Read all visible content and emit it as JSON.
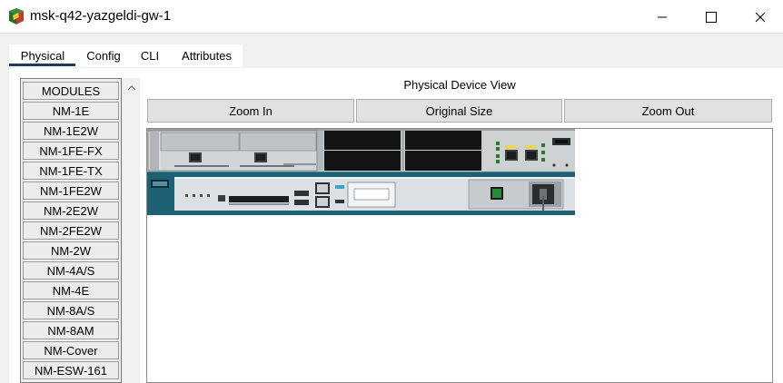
{
  "window": {
    "title": "msk-q42-yazgeldi-gw-1",
    "icon": "router-app-icon"
  },
  "tabs": [
    {
      "label": "Physical",
      "active": true
    },
    {
      "label": "Config",
      "active": false
    },
    {
      "label": "CLI",
      "active": false
    },
    {
      "label": "Attributes",
      "active": false
    }
  ],
  "modules": {
    "header": "MODULES",
    "items": [
      "NM-1E",
      "NM-1E2W",
      "NM-1FE-FX",
      "NM-1FE-TX",
      "NM-1FE2W",
      "NM-2E2W",
      "NM-2FE2W",
      "NM-2W",
      "NM-4A/S",
      "NM-4E",
      "NM-8A/S",
      "NM-8AM",
      "NM-Cover",
      "NM-ESW-161"
    ]
  },
  "physical_view": {
    "title": "Physical Device View",
    "zoom_in": "Zoom In",
    "original_size": "Original Size",
    "zoom_out": "Zoom Out"
  },
  "colors": {
    "tab_underline": "#1e3a5f",
    "chassis_teal": "#1d5f73",
    "chassis_panel": "#d9dcdd"
  }
}
